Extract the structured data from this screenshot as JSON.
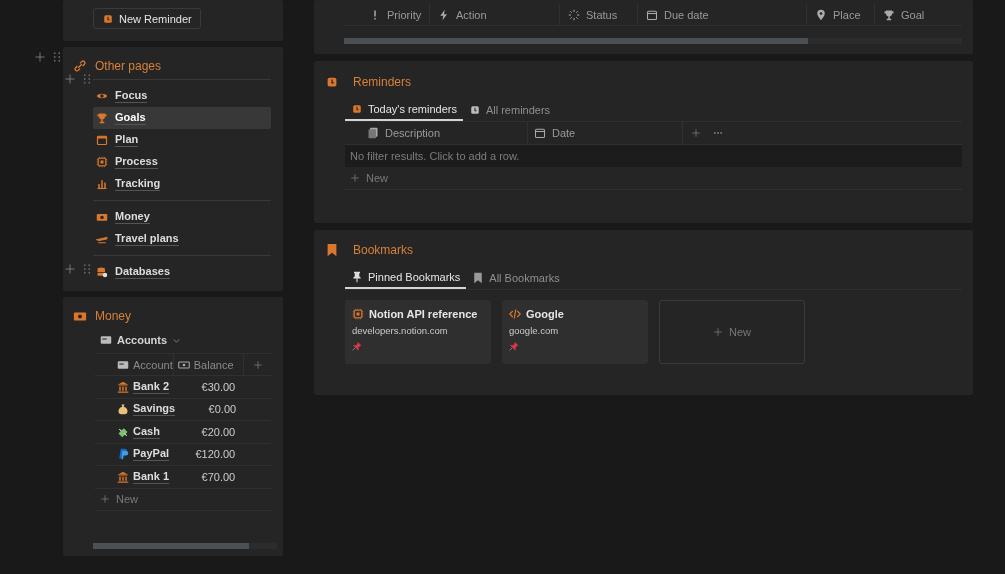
{
  "top_panel": {
    "button": "New Reminder"
  },
  "other_pages": {
    "title": "Other pages",
    "groups": [
      [
        {
          "label": "Focus",
          "selected": false
        },
        {
          "label": "Goals",
          "selected": true
        },
        {
          "label": "Plan",
          "selected": false
        },
        {
          "label": "Process",
          "selected": false
        },
        {
          "label": "Tracking",
          "selected": false
        }
      ],
      [
        {
          "label": "Money",
          "selected": false
        },
        {
          "label": "Travel plans",
          "selected": false
        }
      ]
    ],
    "databases": "Databases"
  },
  "money": {
    "title": "Money",
    "view": "Accounts",
    "columns": [
      "Account",
      "Balance"
    ],
    "rows": [
      {
        "account": "Bank 2",
        "balance": "€30.00"
      },
      {
        "account": "Savings",
        "balance": "€0.00"
      },
      {
        "account": "Cash",
        "balance": "€20.00"
      },
      {
        "account": "PayPal",
        "balance": "€120.00"
      },
      {
        "account": "Bank 1",
        "balance": "€70.00"
      }
    ],
    "new": "New"
  },
  "tasks": {
    "columns": [
      "Priority",
      "Action",
      "Status",
      "Due date",
      "Place",
      "Goal"
    ]
  },
  "reminders": {
    "title": "Reminders",
    "tabs": [
      {
        "label": "Today's reminders",
        "selected": true
      },
      {
        "label": "All reminders",
        "selected": false
      }
    ],
    "columns": [
      "Description",
      "Date"
    ],
    "empty": "No filter results. Click to add a row.",
    "new": "New"
  },
  "bookmarks": {
    "title": "Bookmarks",
    "tabs": [
      {
        "label": "Pinned Bookmarks",
        "selected": true
      },
      {
        "label": "All Bookmarks",
        "selected": false
      }
    ],
    "cards": [
      {
        "title": "Notion API reference",
        "url": "developers.notion.com"
      },
      {
        "title": "Google",
        "url": "google.com"
      }
    ],
    "new": "New"
  }
}
